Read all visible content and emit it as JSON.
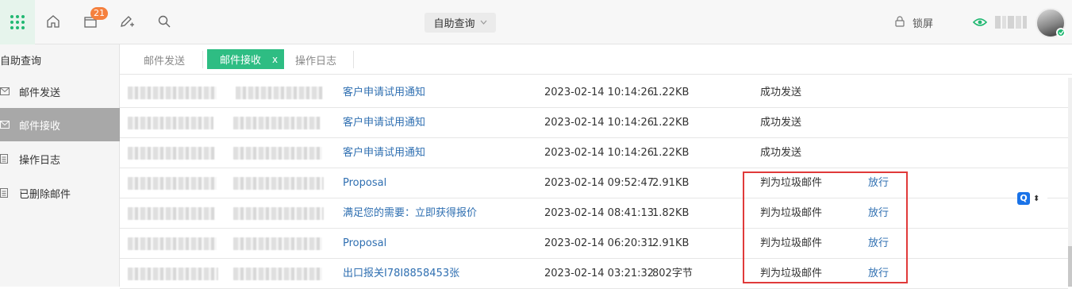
{
  "topbar": {
    "notification_count": "21",
    "module_select": "自助查询",
    "lock_label": "锁屏"
  },
  "sidebar": {
    "title": "自助查询",
    "items": [
      {
        "label": "邮件发送",
        "active": false
      },
      {
        "label": "邮件接收",
        "active": true
      },
      {
        "label": "操作日志",
        "active": false
      },
      {
        "label": "已删除邮件",
        "active": false
      }
    ]
  },
  "tabs": [
    {
      "label": "邮件发送",
      "active": false
    },
    {
      "label": "邮件接收",
      "active": true,
      "close": "x"
    },
    {
      "label": "操作日志",
      "active": false
    }
  ],
  "mails": [
    {
      "subject": "客户申请试用通知",
      "time": "2023-02-14 10:14:26",
      "size": "1.22KB",
      "status": "成功发送",
      "action": ""
    },
    {
      "subject": "客户申请试用通知",
      "time": "2023-02-14 10:14:26",
      "size": "1.22KB",
      "status": "成功发送",
      "action": ""
    },
    {
      "subject": "客户申请试用通知",
      "time": "2023-02-14 10:14:26",
      "size": "1.22KB",
      "status": "成功发送",
      "action": ""
    },
    {
      "subject": "Proposal",
      "time": "2023-02-14 09:52:47",
      "size": "2.91KB",
      "status": "判为垃圾邮件",
      "action": "放行"
    },
    {
      "subject": "满足您的需要：立即获得报价",
      "time": "2023-02-14 08:41:13",
      "size": "1.82KB",
      "status": "判为垃圾邮件",
      "action": "放行"
    },
    {
      "subject": "Proposal",
      "time": "2023-02-14 06:20:31",
      "size": "2.91KB",
      "status": "判为垃圾邮件",
      "action": "放行"
    },
    {
      "subject": "出口报关I78I8858453张",
      "time": "2023-02-14 03:21:32",
      "size": "802字节",
      "status": "判为垃圾邮件",
      "action": "放行"
    }
  ],
  "float_widget": {
    "letter": "Q",
    "arrows": "⬍"
  },
  "colors": {
    "accent": "#2ebd83",
    "link": "#2f6fb1",
    "highlight": "#e03a3a",
    "badge": "#f5803e"
  }
}
